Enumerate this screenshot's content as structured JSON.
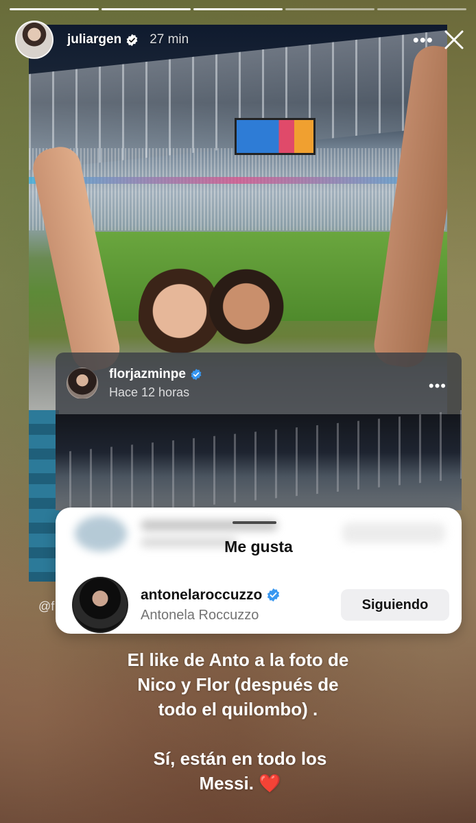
{
  "story": {
    "progress_segments": 5,
    "progress_done": 3,
    "username": "juliargen",
    "time": "27 min",
    "mention": "@f"
  },
  "embedded_post": {
    "username": "florjazminpe",
    "time": "Hace 12 horas"
  },
  "likes_sheet": {
    "title": "Me gusta",
    "user": {
      "username": "antonelaroccuzzo",
      "full_name": "Antonela Roccuzzo",
      "button": "Siguiendo"
    }
  },
  "caption": {
    "line1": "El like de Anto a la foto de Nico y Flor (después de todo el quilombo) .",
    "line2": "Sí, están en todo los Messi.",
    "emoji": "❤️"
  },
  "colors": {
    "verified": "#3897f0",
    "heart": "#e0243a"
  }
}
